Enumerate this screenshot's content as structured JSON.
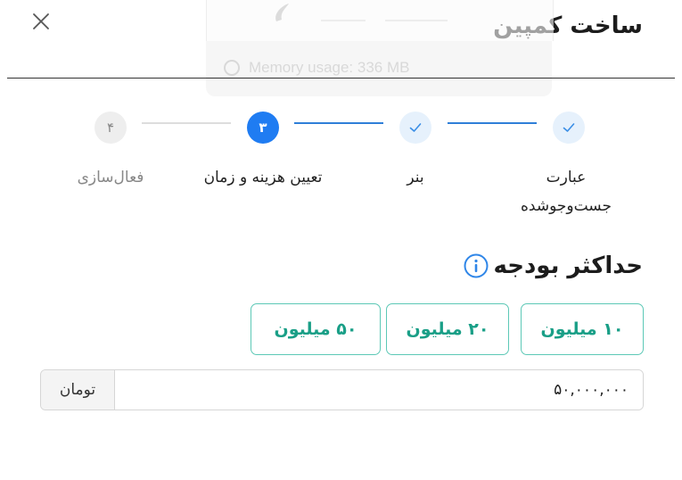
{
  "header": {
    "title": "ساخت کمپین"
  },
  "toast": {
    "text": "Memory usage: 336 MB"
  },
  "stepper": {
    "steps": [
      {
        "number": "",
        "line1": "عبارت",
        "line2": "جست‌وجوشده",
        "state": "done"
      },
      {
        "number": "",
        "line1": "بنر",
        "line2": "",
        "state": "done"
      },
      {
        "number": "۳",
        "line1": "تعیین هزینه و زمان",
        "line2": "",
        "state": "active"
      },
      {
        "number": "۴",
        "line1": "فعال‌سازی",
        "line2": "",
        "state": "pending"
      }
    ]
  },
  "budget": {
    "title": "حداکثر بودجه",
    "presets": [
      "۱۰ میلیون",
      "۲۰ میلیون",
      "۵۰ میلیون"
    ],
    "amount": "۵۰,۰۰۰,۰۰۰",
    "unit": "تومان"
  },
  "colors": {
    "accent": "#1f7cf2",
    "teal": "#1a9f87",
    "step_done_bg": "#e6f1fc"
  }
}
